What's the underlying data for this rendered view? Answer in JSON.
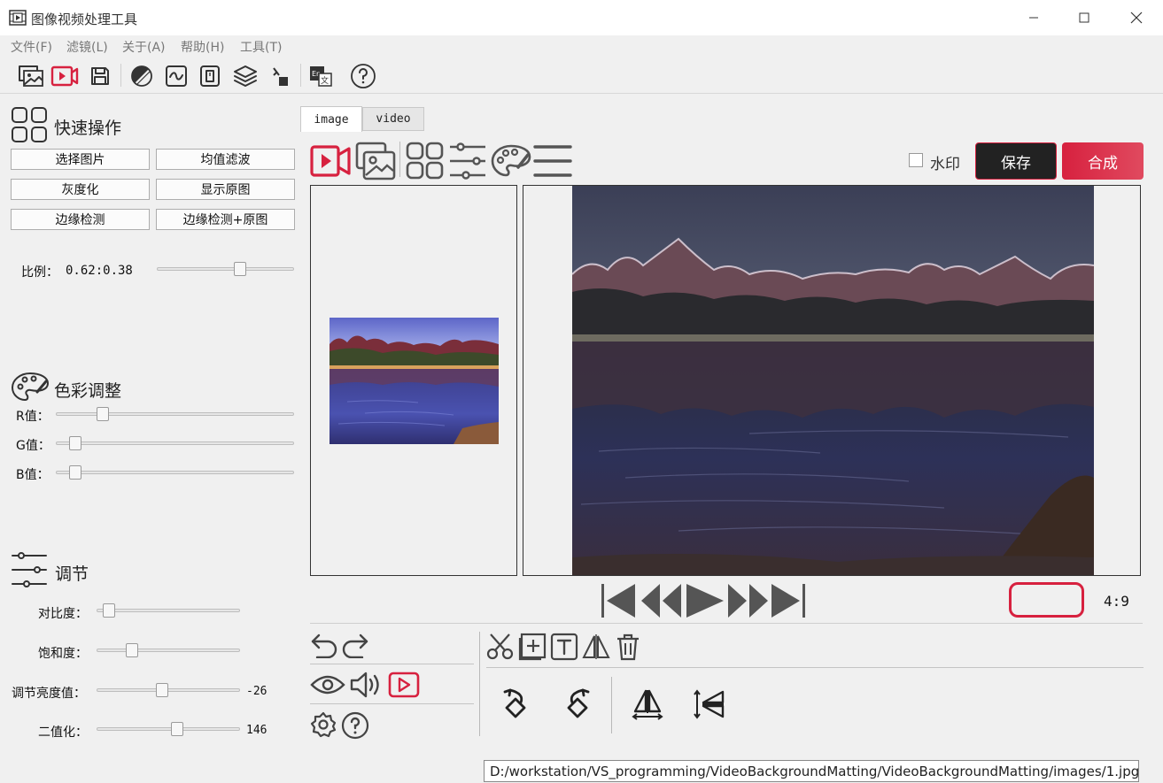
{
  "window": {
    "title": "图像视频处理工具",
    "icons": [
      "film-app-icon",
      "minimize-icon",
      "maximize-icon",
      "close-icon"
    ]
  },
  "menu": {
    "file": "文件(F)",
    "filter": "滤镜(L)",
    "about": "关于(A)",
    "help": "帮助(H)",
    "tools": "工具(T)"
  },
  "toolbar_icons": [
    "open-image-icon",
    "open-video-icon",
    "save-icon",
    "grayscale-icon",
    "curve-icon",
    "dial-icon",
    "layers-icon",
    "crop-icon",
    "translate-icon",
    "help-icon"
  ],
  "quick_ops": {
    "title": "快速操作",
    "buttons": [
      "选择图片",
      "均值滤波",
      "灰度化",
      "显示原图",
      "边缘检测",
      "边缘检测+原图"
    ],
    "ratio_label": "比例：",
    "ratio_value": "0.62:0.38",
    "ratio_fraction": 0.62
  },
  "color_adjust": {
    "title": "色彩调整",
    "r_label": "R值：",
    "g_label": "G值：",
    "b_label": "B值：",
    "r_level": 0.18,
    "g_level": 0.06,
    "b_level": 0.06
  },
  "adjust": {
    "title": "调节",
    "contrast_label": "对比度：",
    "saturation_label": "饱和度：",
    "brightness_label": "调节亮度值：",
    "brightness_value": "-26",
    "binarize_label": "二值化：",
    "binarize_value": "146",
    "contrast_level": 0.05,
    "saturation_level": 0.22,
    "brightness_level": 0.45,
    "binarize_level": 0.57
  },
  "tabs": [
    "image",
    "video"
  ],
  "active_tab": "image",
  "panel": {
    "watermark_label": "水印",
    "save_label": "保存",
    "compose_label": "合成",
    "aspect_ratio": "4:9",
    "accent": "#d7213f",
    "dark": "#222222"
  },
  "status": {
    "path": "D:/workstation/VS_programming/VideoBackgroundMatting/VideoBackgroundMatting/images/1.jpg"
  }
}
